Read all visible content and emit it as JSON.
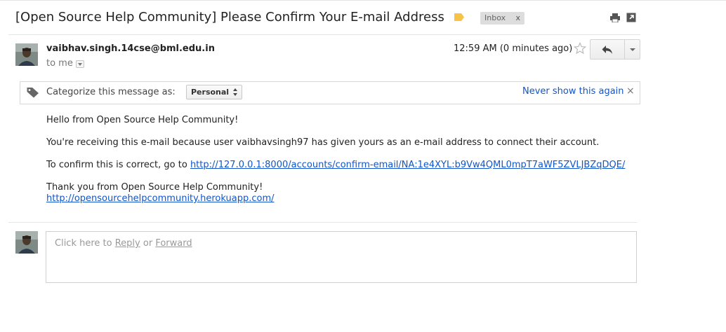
{
  "subject": "[Open Source Help Community] Please Confirm Your E-mail Address",
  "labels": {
    "inbox": "Inbox",
    "remove": "x"
  },
  "sender": {
    "email": "vaibhav.singh.14cse@bml.edu.in",
    "recipient": "to me"
  },
  "time": "12:59 AM (0 minutes ago)",
  "categorize": {
    "prompt": "Categorize this message as:",
    "selected": "Personal",
    "never_show": "Never show this again",
    "close": "×"
  },
  "body": {
    "greeting": "Hello from Open Source Help Community!",
    "reason": "You're receiving this e-mail because user vaibhavsingh97 has given yours as an e-mail address to connect their account.",
    "confirm_prefix": "To confirm this is correct, go to ",
    "confirm_link": "http://127.0.0.1:8000/accounts/confirm-email/NA:1e4XYL:b9Vw4QML0mpT7aWF5ZVLJBZqDQE/",
    "thanks": "Thank you from Open Source Help Community!",
    "site_link": "http://opensourcehelpcommunity.herokuapp.com/"
  },
  "reply_box": {
    "prefix": "Click here to ",
    "reply": "Reply",
    "or": " or ",
    "forward": "Forward"
  },
  "colors": {
    "link": "#1155cc",
    "label_tag": "#f6c344"
  }
}
